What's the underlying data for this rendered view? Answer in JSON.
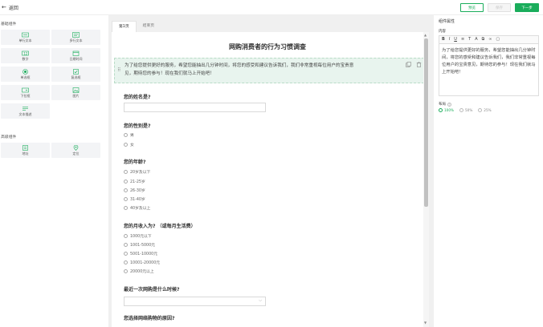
{
  "header": {
    "back_label": "返回",
    "preview_label": "预览",
    "save_label": "保存",
    "next_label": "下一步"
  },
  "left_panel": {
    "basic_title": "基础组件",
    "basic_items": [
      {
        "label": "单行文本",
        "icon": "single-line-text-icon"
      },
      {
        "label": "多行文本",
        "icon": "multi-line-text-icon"
      },
      {
        "label": "数字",
        "icon": "number-icon"
      },
      {
        "label": "日期时间",
        "icon": "datetime-icon"
      },
      {
        "label": "单选框",
        "icon": "radio-icon"
      },
      {
        "label": "复选框",
        "icon": "checkbox-icon"
      },
      {
        "label": "下拉框",
        "icon": "dropdown-icon"
      },
      {
        "label": "图片",
        "icon": "image-icon"
      },
      {
        "label": "文本描述",
        "icon": "text-description-icon"
      }
    ],
    "advanced_title": "高级组件",
    "advanced_items": [
      {
        "label": "地址",
        "icon": "address-icon"
      },
      {
        "label": "定位",
        "icon": "location-icon"
      }
    ]
  },
  "tabs": [
    {
      "label": "第1页",
      "active": true
    },
    {
      "label": "结束页",
      "active": false
    }
  ],
  "form": {
    "title": "网购消费者的行为习惯调查",
    "description_line1": "为了给您提供更好的服务，希望您能抽出几分钟时间，将您的感受和建议告诉我们，我们非常重视每位用户的宝贵意",
    "description_line2": "见，期待您的参与！现在我们就马上开始吧！",
    "questions": [
      {
        "title": "您的姓名是?",
        "type": "text"
      },
      {
        "title": "您的性别是?",
        "type": "radio",
        "options": [
          "男",
          "女"
        ]
      },
      {
        "title": "您的年龄?",
        "type": "radio",
        "options": [
          "20岁及以下",
          "21-25岁",
          "26-30岁",
          "31-40岁",
          "40岁及以上"
        ]
      },
      {
        "title": "您的月收入为?  （或每月生活费）",
        "type": "radio",
        "options": [
          "1000元以下",
          "1001-5000元",
          "5001-10000元",
          "10001-20000元",
          "20000元以上"
        ]
      },
      {
        "title": "最近一次网购是什么时候?",
        "type": "select"
      },
      {
        "title": "您选择网络购物的原因?",
        "type": "text"
      }
    ]
  },
  "right_panel": {
    "title": "组件属性",
    "content_label": "内容",
    "toolbar": [
      "B",
      "I",
      "U",
      "≡",
      "T",
      "A",
      "⧉",
      "∞",
      "▢"
    ],
    "editor_text": "为了给您提供更好的服务，希望您能抽出几分钟时间，将您的感受和建议告诉我们，我们非常重视每位用户的宝贵意见，期待您的参与！现在我们就马上开始吧！",
    "layout_label": "布局",
    "layout_options": [
      {
        "label": "100%",
        "selected": true
      },
      {
        "label": "50%",
        "selected": false
      },
      {
        "label": "25%",
        "selected": false
      }
    ]
  },
  "colors": {
    "accent": "#1aad5b",
    "description_bg": "#e8f4ee",
    "canvas_bg": "#f0f0f0"
  }
}
